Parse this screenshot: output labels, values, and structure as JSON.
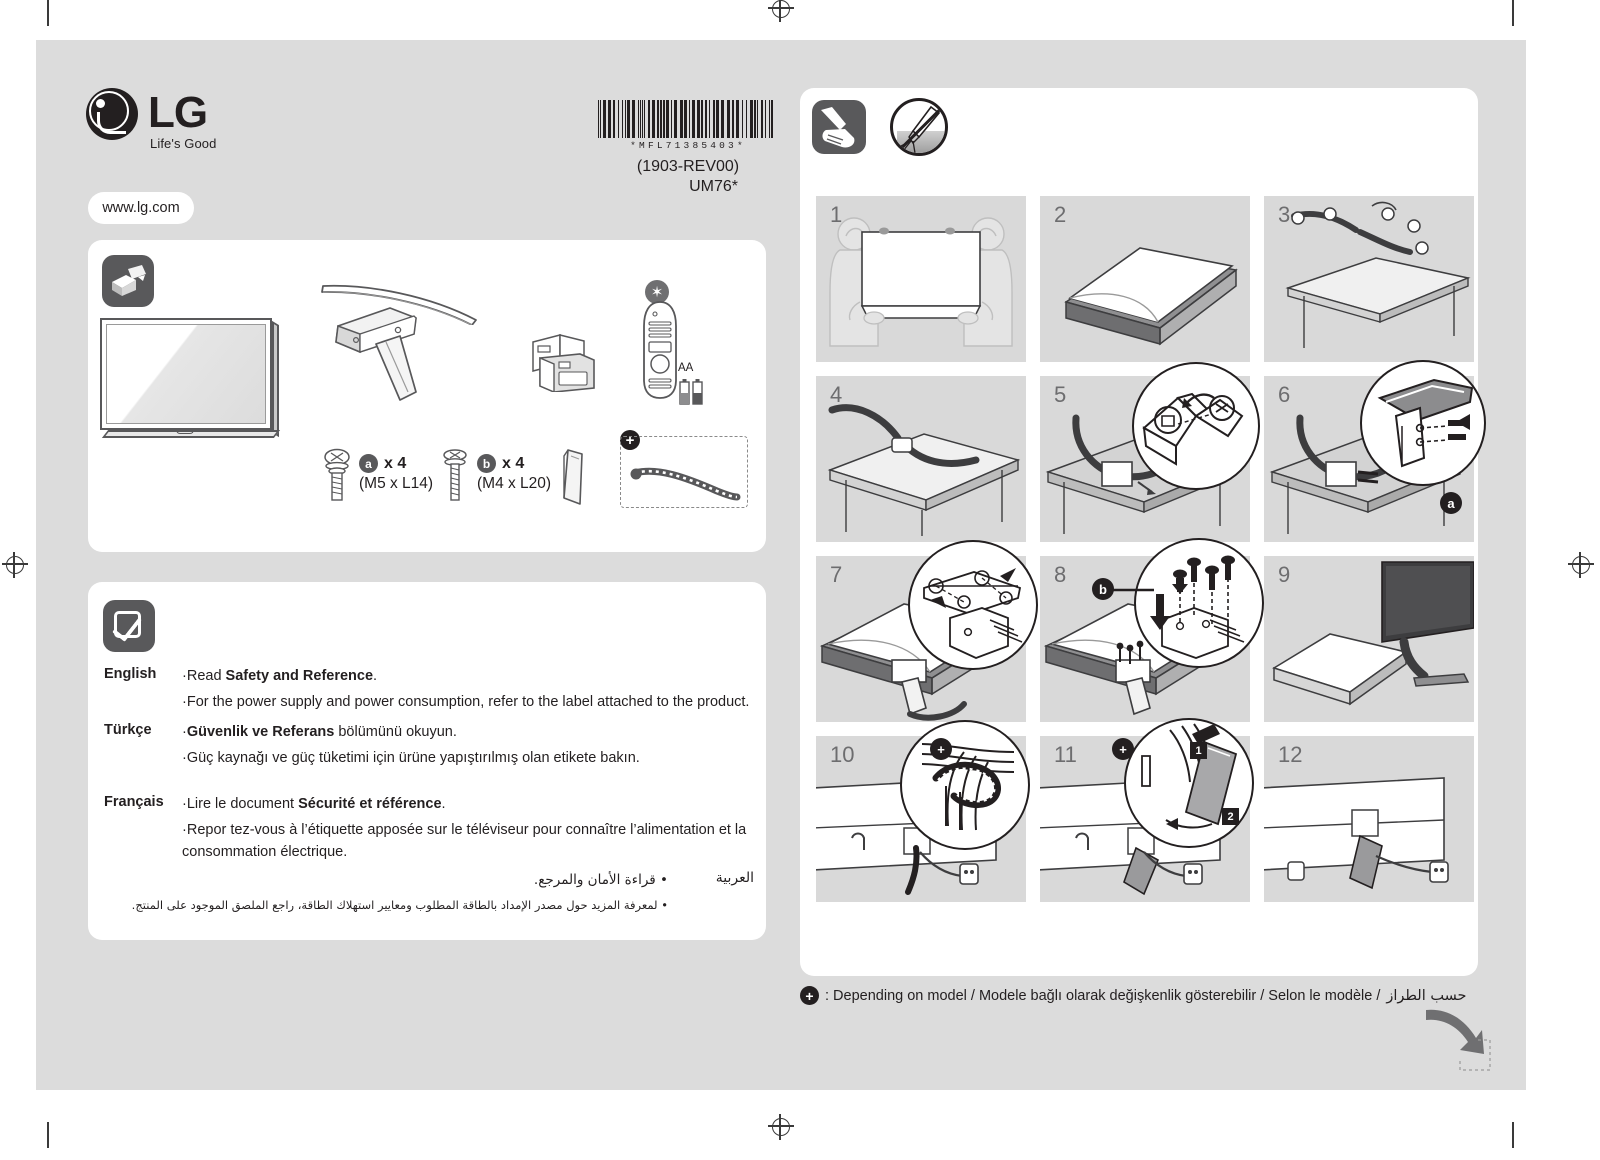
{
  "document": {
    "brand_name": "LG",
    "brand_tagline": "Life's Good",
    "website": "www.lg.com",
    "barcode_digits": "*MFL71385403*",
    "revision": "(1903-REV00)",
    "model": "UM76*"
  },
  "accessories": {
    "icon": "unbox-icon",
    "items": [
      {
        "name": "tv-panel"
      },
      {
        "name": "stand-base"
      },
      {
        "name": "stand-neck"
      },
      {
        "name": "manuals"
      },
      {
        "name": "magic-remote",
        "badge": "bluetooth",
        "battery_label": "AA"
      },
      {
        "name": "cable-cover"
      },
      {
        "name": "cable-tie",
        "optional": true
      }
    ],
    "screws": [
      {
        "badge": "a",
        "qty": "x 4",
        "spec": "(M5 x L14)"
      },
      {
        "badge": "b",
        "qty": "x 4",
        "spec": "(M4 x L20)"
      }
    ],
    "optional_badge": "+"
  },
  "notice": {
    "icon": "check-icon",
    "languages": [
      {
        "name": "English",
        "lines": [
          {
            "bullet": "·",
            "pre": "Read ",
            "bold": "Safety and Reference",
            "post": "."
          },
          {
            "bullet": "·",
            "pre": "For the power supply and power consumption,  refer to the label attached to the product.",
            "bold": "",
            "post": ""
          }
        ]
      },
      {
        "name": "Türkçe",
        "lines": [
          {
            "bullet": "·",
            "pre": "",
            "bold": "Güvenlik ve Referans",
            "post": " bölümünü okuyun."
          },
          {
            "bullet": "·",
            "pre": "Güç kaynağı ve güç tüketimi için ürüne yapıştırılmış  olan etikete bakın.",
            "bold": "",
            "post": ""
          }
        ]
      },
      {
        "name": "Français",
        "lines": [
          {
            "bullet": "·",
            "pre": "Lire le document  ",
            "bold": "Sécurité et référence",
            "post": "."
          },
          {
            "bullet": "·",
            "pre": "Repor tez-vous à l’étiquette apposée sur le téléviseur pour connaître l’alimentation et la consommation électrique.",
            "bold": "",
            "post": ""
          }
        ]
      }
    ],
    "arabic": {
      "name": "العربية",
      "line1": "•  قراءة الأمان والمرجع.",
      "line2": "•  لمعرفة المزيد حول مصدر الإمداد بالطاقة المطلوب ومعايير استهلاك الطاقة، راجع الملصق الموجود على المنتج."
    }
  },
  "steps_panel": {
    "header_icons": [
      {
        "name": "screwdriver-by-hand-icon"
      },
      {
        "name": "no-power-drill-icon"
      }
    ],
    "steps": [
      {
        "num": "1",
        "art": "two-people-lift-tv"
      },
      {
        "num": "2",
        "art": "tv-face-down-on-cloth"
      },
      {
        "num": "3",
        "art": "stand-base-on-table"
      },
      {
        "num": "4",
        "art": "stand-base-aligned"
      },
      {
        "num": "5",
        "art": "insert-stand-neck",
        "callout": true
      },
      {
        "num": "6",
        "art": "tighten-screw-a",
        "callout": true,
        "badge": "a"
      },
      {
        "num": "7",
        "art": "align-stand-to-tv",
        "callout": true
      },
      {
        "num": "8",
        "art": "fasten-screws-b",
        "callout": true,
        "badge": "b"
      },
      {
        "num": "9",
        "art": "stand-tv-upright"
      },
      {
        "num": "10",
        "art": "route-cables",
        "callout": true,
        "plus": "+"
      },
      {
        "num": "11",
        "art": "attach-cable-cover",
        "callout": true,
        "plus": "+",
        "seq": [
          "1",
          "2"
        ]
      },
      {
        "num": "12",
        "art": "finished-rear-view"
      }
    ]
  },
  "footer": {
    "badge": "+",
    "text": ": Depending on model / Modele bağlı olarak değişkenlik gösterebilir / Selon le modèle / ",
    "arabic": "حسب الطراز"
  },
  "colors": {
    "board": "#dcdcdc",
    "card": "#ffffff",
    "step_panel": "#d9d9d9",
    "ink": "#231f20",
    "icon_dark": "#59595b",
    "step_num": "#6d6d6f"
  }
}
